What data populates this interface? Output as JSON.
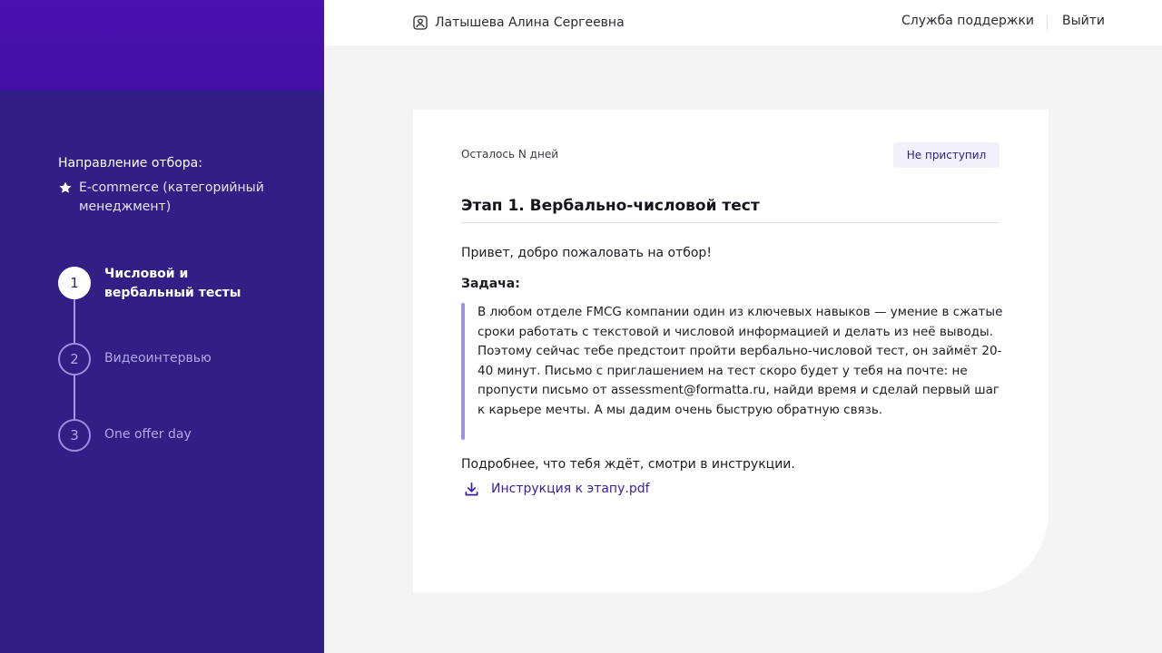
{
  "sidebar": {
    "direction_title": "Направление отбора:",
    "direction_value": "E-commerce (категорийный менеджмент)",
    "steps": [
      {
        "number": "1",
        "label": "Числовой и вербальный тесты",
        "state": "active"
      },
      {
        "number": "2",
        "label": "Видеоинтервью",
        "state": "pending"
      },
      {
        "number": "3",
        "label": "One offer day",
        "state": "pending"
      }
    ]
  },
  "header": {
    "user_name": "Латышева Алина Сергеевна",
    "support_label": "Служба поддержки",
    "logout_label": "Выйти"
  },
  "card": {
    "days_left": "Осталось N дней",
    "status": "Не приступил",
    "title": "Этап 1. Вербально-числовой тест",
    "greeting": "Привет, добро пожаловать на отбор!",
    "task_label": "Задача:",
    "task_text": "В любом отделе FMCG компании один из ключевых навыков — умение в сжатые сроки работать с текстовой и числовой информацией и делать из неё выводы. Поэтому сейчас тебе предстоит пройти вербально-числовой тест, он займёт 20-40 минут. Письмо с приглашением на тест скоро будет у тебя на почте: не пропусти письмо от assessment@formatta.ru, найди время и сделай первый шаг к карьере мечты. А мы дадим очень быструю обратную связь.",
    "more_info": "Подробнее, что тебя ждёт, смотри в инструкции.",
    "pdf_link": "Инструкция к этапу.pdf"
  },
  "colors": {
    "sidebar_bg": "#311f86",
    "sidebar_top": "#4a12b0",
    "accent": "#3a1ea0",
    "quote_bar": "#9e94dd"
  },
  "icons": {
    "user": "user-badge-icon",
    "star": "star-icon",
    "download": "download-icon"
  }
}
